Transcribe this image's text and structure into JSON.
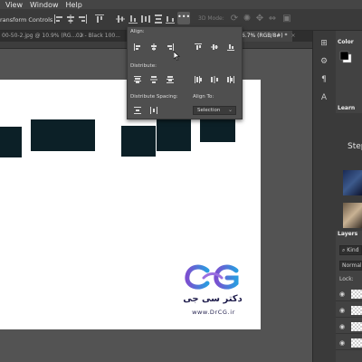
{
  "menu": {
    "items": [
      "View",
      "Window",
      "Help"
    ]
  },
  "options_bar": {
    "transform_controls_label": "ransform Controls",
    "more_label": "•••",
    "mode_3d_label": "3D Mode:"
  },
  "tabs": [
    {
      "label": "00-50-2.jpg @ 10.9% (RG...",
      "close": "×"
    },
    {
      "label": "02 - Black 100...",
      "close": ""
    },
    {
      "label": "6.7% (RGB/8#) *",
      "close": "×"
    }
  ],
  "align_panel": {
    "align_label": "Align:",
    "distribute_label": "Distribute:",
    "distribute_spacing_label": "Distribute Spacing:",
    "align_to_label": "Align To:",
    "align_to_value": "Selection"
  },
  "logo": {
    "persian_text": "دکتر سی جی",
    "url_text": "www.DrCG.ir"
  },
  "right_panel": {
    "color_tab": "Color",
    "learn_tab": "Learn",
    "steps_text": "Step",
    "layers_tab": "Layers",
    "kind_placeholder": "Kind",
    "blend_mode": "Normal",
    "lock_label": "Lock:"
  },
  "colors": {
    "canvas_rect": "#0c2027",
    "logo_purple": "#7b4fd0",
    "logo_blue": "#2a9be0",
    "logo_text": "#1e1c4b"
  }
}
